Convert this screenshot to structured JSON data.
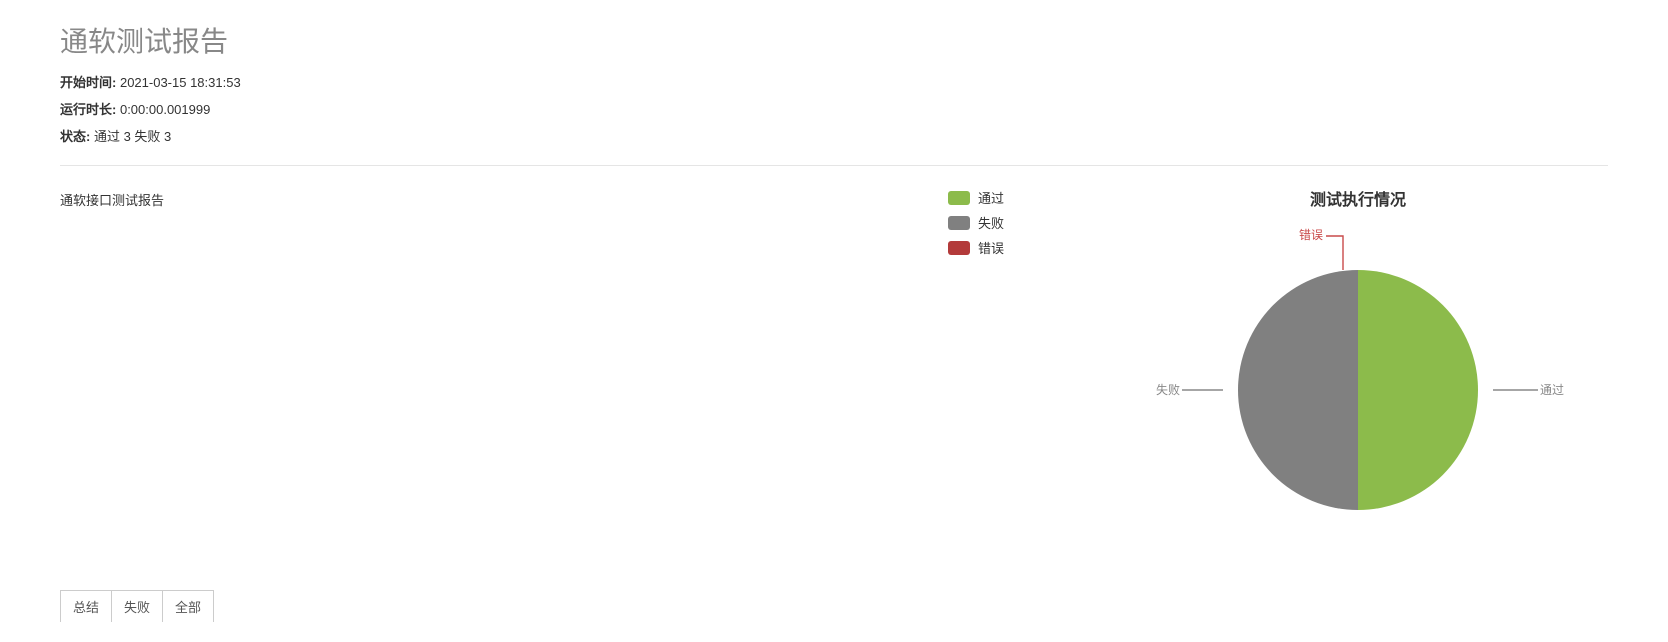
{
  "title": "通软测试报告",
  "meta": {
    "start_label": "开始时间:",
    "start_value": "2021-03-15 18:31:53",
    "duration_label": "运行时长:",
    "duration_value": "0:00:00.001999",
    "status_label": "状态:",
    "status_value": "通过 3 失败 3"
  },
  "description": "通软接口测试报告",
  "legend": {
    "pass": {
      "label": "通过",
      "color": "#8cbb4b"
    },
    "fail": {
      "label": "失败",
      "color": "#808080"
    },
    "error": {
      "label": "错误",
      "color": "#b33a3a"
    }
  },
  "chart": {
    "title": "测试执行情况",
    "slice_pass_label": "通过",
    "slice_fail_label": "失败",
    "slice_error_label": "错误"
  },
  "chart_data": {
    "type": "pie",
    "title": "测试执行情况",
    "series": [
      {
        "name": "通过",
        "value": 3,
        "color": "#8cbb4b"
      },
      {
        "name": "失败",
        "value": 3,
        "color": "#808080"
      },
      {
        "name": "错误",
        "value": 0,
        "color": "#b33a3a"
      }
    ]
  },
  "tabs": {
    "summary": "总结",
    "fail": "失败",
    "all": "全部"
  }
}
